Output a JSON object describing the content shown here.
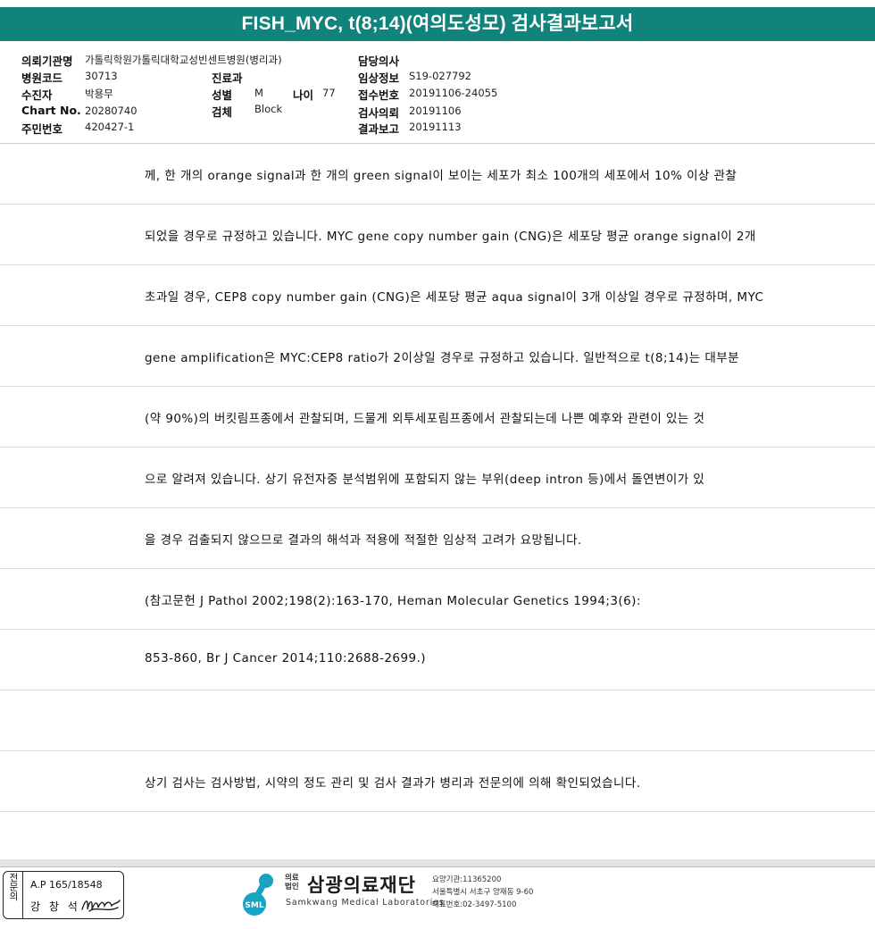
{
  "title": "FISH_MYC, t(8;14)(여의도성모) 검사결과보고서",
  "info": {
    "hospital_label": "의뢰기관명",
    "hospital_value": "가톨릭학원가톨릭대학교성빈센트병원(병리과)",
    "hospital_code_label": "병원코드",
    "hospital_code_value": "30713",
    "department_label": "진료과",
    "patient_label": "수진자",
    "patient_value": "박용무",
    "sex_label": "성별",
    "sex_value": "M",
    "age_label": "나이",
    "age_value": "77",
    "chart_label": "Chart No.",
    "chart_value": "20280740",
    "specimen_label": "검체",
    "specimen_value": "Block",
    "resident_label": "주민번호",
    "resident_value": "420427-1",
    "doctor_label": "담당의사",
    "clinical_label": "임상정보",
    "clinical_value": "S19-027792",
    "receipt_label": "접수번호",
    "receipt_value": "20191106-24055",
    "request_label": "검사의뢰",
    "request_value": "20191106",
    "report_label": "결과보고",
    "report_value": "20191113"
  },
  "body_lines": [
    "께, 한 개의 orange signal과 한 개의 green signal이 보이는 세포가 최소 100개의 세포에서 10% 이상 관찰",
    "되었을 경우로 규정하고 있습니다. MYC gene copy number gain (CNG)은 세포당 평균 orange signal이 2개",
    "초과일 경우, CEP8 copy number gain (CNG)은 세포당 평균 aqua signal이 3개 이상일 경우로 규정하며, MYC",
    " gene amplification은 MYC:CEP8 ratio가 2이상일 경우로 규정하고 있습니다. 일반적으로 t(8;14)는 대부분",
    "(약 90%)의 버킷림프종에서 관찰되며, 드물게 외투세포림프종에서 관찰되는데 나쁜 예후와 관련이 있는 것",
    "으로 알려져 있습니다. 상기 유전자중 분석범위에 포함되지 않는 부위(deep intron 등)에서 돌연변이가 있",
    "을 경우 검출되지 않으므로 결과의 해석과 적용에 적절한 임상적 고려가 요망됩니다.",
    "(참고문헌 J Pathol 2002;198(2):163-170, Heman Molecular Genetics 1994;3(6):",
    "853-860, Br J Cancer 2014;110:2688-2699.)",
    "",
    "상기 검사는 검사방법, 시약의 정도 관리 및 검사 결과가 병리과 전문의에 의해 확인되었습니다."
  ],
  "footer": {
    "stamp_vertical": "전문의",
    "stamp_ap": "A.P 165/18548",
    "stamp_name": "강 창 석",
    "logo_mark": "SML",
    "org_small": "의료법인",
    "org_name": "삼광의료재단",
    "org_eng": "Samkwang Medical Laboratories",
    "org_code": "요양기관:11365200",
    "org_address": "서울특별시 서초구 양재동 9-60",
    "org_phone": "대표번호:02-3497-5100"
  },
  "colors": {
    "title_bar": "#10837a",
    "logo": "#18a3c4"
  }
}
